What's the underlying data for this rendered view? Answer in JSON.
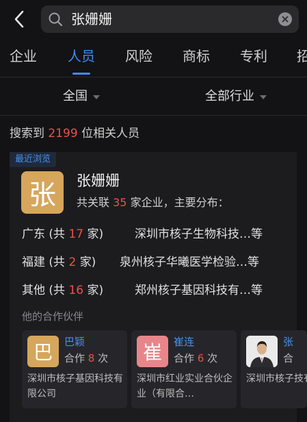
{
  "search": {
    "query": "张姗姗"
  },
  "tabs": [
    {
      "label": "企业"
    },
    {
      "label": "人员"
    },
    {
      "label": "风险"
    },
    {
      "label": "商标"
    },
    {
      "label": "专利"
    },
    {
      "label": "招"
    }
  ],
  "active_tab": "人员",
  "filters": {
    "region": "全国",
    "industry": "全部行业"
  },
  "result": {
    "prefix": "搜索到",
    "count": "2199",
    "suffix": "位相关人员"
  },
  "card": {
    "recent_badge": "最近浏览",
    "avatar_char": "张",
    "name": "张姗姗",
    "assoc_prefix": "共关联",
    "assoc_count": "35",
    "assoc_suffix": "家企业，主要分布：",
    "distribution": [
      {
        "region": "广东",
        "pre": "(共",
        "count": "17",
        "post": "家)",
        "company": "深圳市核子生物科技…等"
      },
      {
        "region": "福建",
        "pre": "(共",
        "count": "2",
        "post": "家)",
        "company": "泉州核子华曦医学检验…等"
      },
      {
        "region": "其他",
        "pre": "(共",
        "count": "16",
        "post": "家)",
        "company": "郑州核子基因科技有…等"
      }
    ],
    "partners_title": "他的合作伙伴",
    "partners": [
      {
        "avatar_char": "巴",
        "avatar_color": "#d6a65c",
        "name": "巴颖",
        "coop_pre": "合作",
        "coop_count": "8",
        "coop_post": "次",
        "company": "深圳市核子基因科技有限公司"
      },
      {
        "avatar_char": "崔",
        "avatar_color": "#e8858a",
        "name": "崔连",
        "coop_pre": "合作",
        "coop_count": "6",
        "coop_post": "次",
        "company": "深圳市红业实业合伙企业（有限合…"
      },
      {
        "avatar_char": "",
        "avatar_color": "#e8e8e8",
        "name": "张",
        "coop_pre": "合",
        "coop_count": "",
        "coop_post": "",
        "company": "深圳市核子技有限公"
      }
    ]
  },
  "colors": {
    "accent": "#3f8cff",
    "highlight": "#e6544a",
    "background": "#131315"
  }
}
